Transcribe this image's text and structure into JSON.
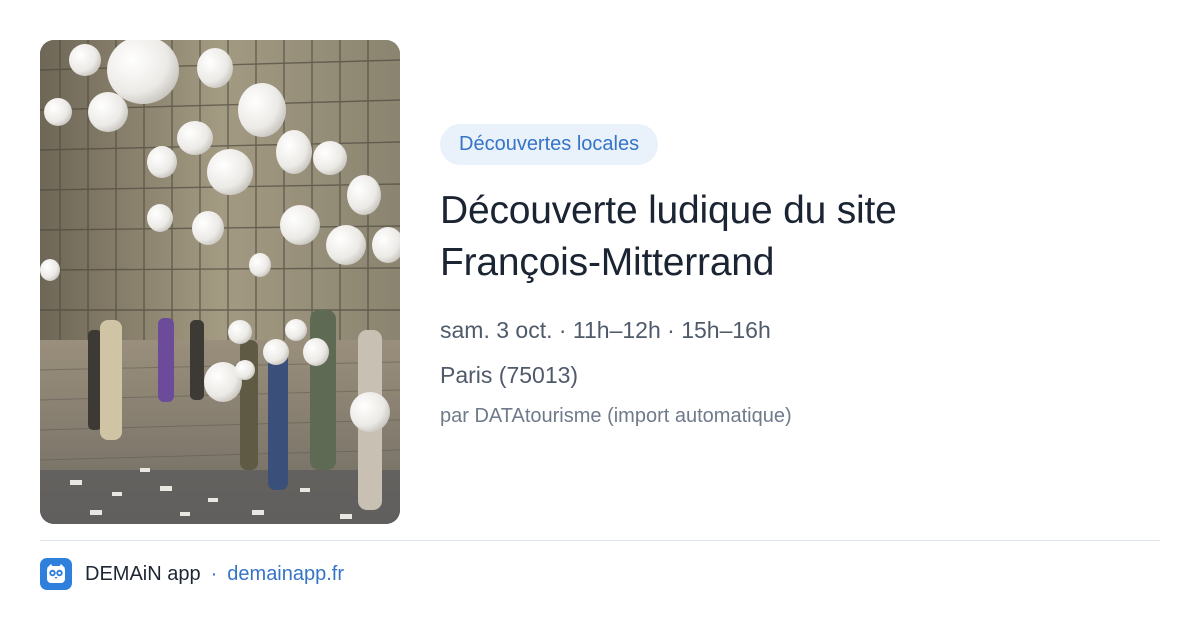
{
  "event": {
    "category_tag": "Découvertes locales",
    "title_line1": "Découverte ludique du site",
    "title_line2": "François-Mitterrand",
    "schedule": "sam. 3 oct. · 11h–12h · 15h–16h",
    "location": "Paris (75013)",
    "source": "par DATAtourisme (import automatique)"
  },
  "footer": {
    "app_name": "DEMAiN app",
    "separator": "·",
    "domain": "demainapp.fr"
  },
  "colors": {
    "accent": "#3574c6",
    "tag_background": "#e9f1fb",
    "app_icon": "#2f7fdc"
  },
  "icons": {
    "app_logo": "owl-logo-icon"
  }
}
